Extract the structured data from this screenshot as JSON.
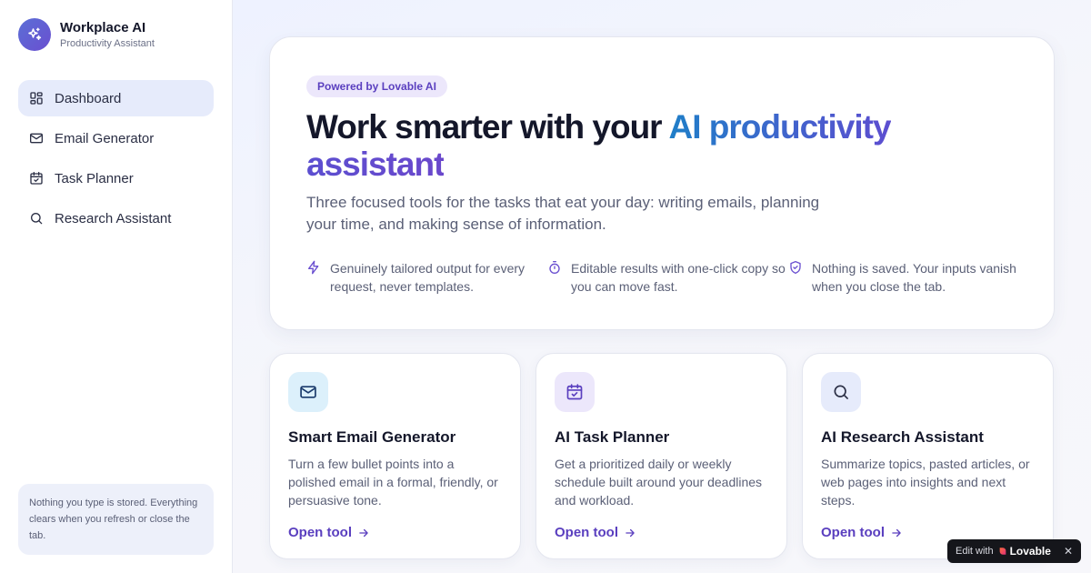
{
  "brand": {
    "title": "Workplace AI",
    "subtitle": "Productivity Assistant",
    "icon": "sparkles-icon"
  },
  "sidebar": {
    "items": [
      {
        "label": "Dashboard",
        "icon": "dashboard-grid-icon",
        "active": true
      },
      {
        "label": "Email Generator",
        "icon": "mail-icon",
        "active": false
      },
      {
        "label": "Task Planner",
        "icon": "calendar-check-icon",
        "active": false
      },
      {
        "label": "Research Assistant",
        "icon": "search-icon",
        "active": false
      }
    ],
    "note": "Nothing you type is stored. Everything clears when you refresh or close the tab."
  },
  "hero": {
    "badge": "Powered by Lovable AI",
    "title_plain": "Work smarter with your ",
    "title_highlight": "AI productivity assistant",
    "description": "Three focused tools for the tasks that eat your day: writing emails, planning your time, and making sense of information.",
    "features": [
      {
        "icon": "lightning-icon",
        "text": "Genuinely tailored output for every request, never templates."
      },
      {
        "icon": "timer-icon",
        "text": "Editable results with one-click copy so you can move fast."
      },
      {
        "icon": "shield-check-icon",
        "text": "Nothing is saved. Your inputs vanish when you close the tab."
      }
    ]
  },
  "cards": [
    {
      "icon": "mail-icon",
      "title": "Smart Email Generator",
      "description": "Turn a few bullet points into a polished email in a formal, friendly, or persuasive tone.",
      "link": "Open tool"
    },
    {
      "icon": "calendar-check-icon",
      "title": "AI Task Planner",
      "description": "Get a prioritized daily or weekly schedule built around your deadlines and workload.",
      "link": "Open tool"
    },
    {
      "icon": "search-icon",
      "title": "AI Research Assistant",
      "description": "Summarize topics, pasted articles, or web pages into insights and next steps.",
      "link": "Open tool"
    }
  ],
  "edit_badge": {
    "prefix": "Edit with",
    "brand": "Lovable",
    "close": "✕"
  },
  "colors": {
    "accent": "#5a3fbf",
    "nav_active_bg": "#e6ebfb",
    "logo_gradient_start": "#5b6fd6",
    "logo_gradient_end": "#6a4fd0"
  }
}
